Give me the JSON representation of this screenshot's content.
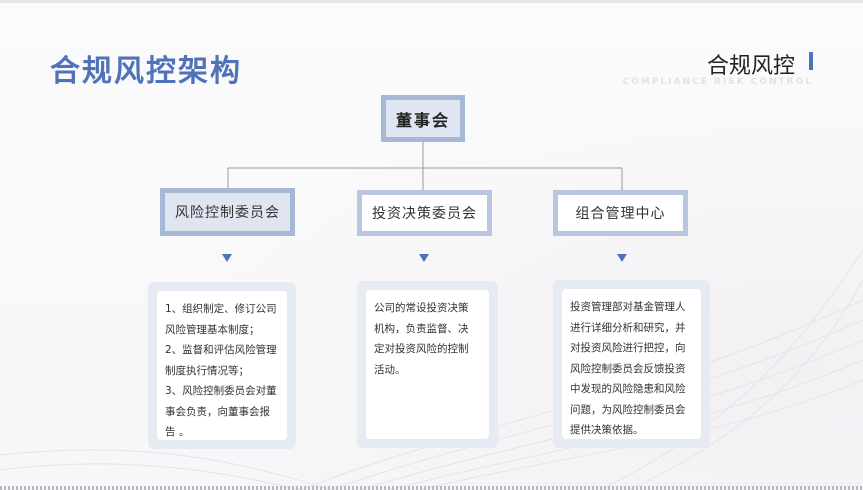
{
  "header": {
    "title": "合规风控架构",
    "brand": "合规风控",
    "brand_sub": "COMPLIANCE RISK CONTROL"
  },
  "org": {
    "root": "董事会",
    "committees": [
      {
        "name": "风险控制委员会",
        "duties": [
          "1、组织制定、修订公司",
          "风险管理基本制度；",
          "2、监督和评估风险管理",
          "制度执行情况等；",
          "3、风险控制委员会对董",
          "事会负责，向董事会报",
          "告 。"
        ]
      },
      {
        "name": "投资决策委员会",
        "duties": [
          "公司的常设投资决策",
          "机构，负责监督、决",
          "定对投资风险的控制",
          "活动。"
        ]
      },
      {
        "name": "组合管理中心",
        "duties": [
          "投资管理部对基金管理人",
          "进行详细分析和研究，并",
          "对投资风险进行把控，向",
          "风险控制委员会反馈投资",
          "中发现的风险隐患和风险",
          "问题，为风险控制委员会",
          "提供决策依据。"
        ]
      }
    ]
  },
  "colors": {
    "accent": "#4f72b8",
    "node_border": "#a7b8d6",
    "node_fill": "#dfe5f1",
    "card_frame": "#e6eaf3"
  }
}
